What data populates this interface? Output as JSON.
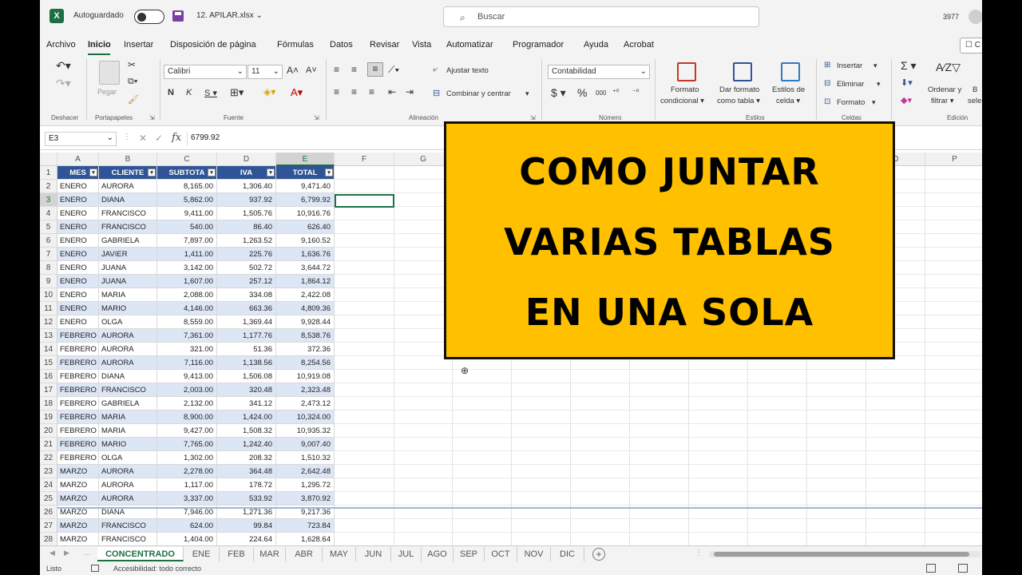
{
  "titlebar": {
    "autosave_label": "Autoguardado",
    "filename": "12. APILAR.xlsx ⌄",
    "search_placeholder": "Buscar",
    "user_text": "3977"
  },
  "menu": [
    "Archivo",
    "Inicio",
    "Insertar",
    "Disposición de página",
    "Fórmulas",
    "Datos",
    "Revisar",
    "Vista",
    "Automatizar",
    "Programador",
    "Ayuda",
    "Acrobat"
  ],
  "ribbon": {
    "undo_group": "Deshacer",
    "clipboard_group": "Portapapeles",
    "paste_label": "Pegar",
    "font_name": "Calibri",
    "font_size": "11",
    "font_group": "Fuente",
    "wrap_text": "Ajustar texto",
    "merge_center": "Combinar y centrar",
    "alignment_group": "Alineación",
    "number_format": "Contabilidad",
    "number_group": "Número",
    "cond_format_1": "Formato",
    "cond_format_2": "condicional ▾",
    "table_format_1": "Dar formato",
    "table_format_2": "como tabla ▾",
    "cell_styles_1": "Estilos de",
    "cell_styles_2": "celda ▾",
    "styles_group": "Estilos",
    "insert": "Insertar",
    "delete": "Eliminar",
    "format": "Formato",
    "cells_group": "Celdas",
    "sort_1": "Ordenar y",
    "sort_2": "filtrar ▾",
    "select_1": "B",
    "select_2": "sele",
    "edit_group": "Edición"
  },
  "formula_bar": {
    "name_box": "E3",
    "formula": "6799.92"
  },
  "columns": [
    "A",
    "B",
    "C",
    "D",
    "E",
    "F",
    "G",
    "H",
    "I",
    "J",
    "K",
    "L",
    "M",
    "N",
    "O",
    "P"
  ],
  "table": {
    "headers": [
      "MES",
      "CLIENTE",
      "SUBTOTA",
      "IVA",
      "TOTAL"
    ],
    "rows": [
      [
        "ENERO",
        "AURORA",
        "8,165.00",
        "1,306.40",
        "9,471.40"
      ],
      [
        "ENERO",
        "DIANA",
        "5,862.00",
        "937.92",
        "6,799.92"
      ],
      [
        "ENERO",
        "FRANCISCO",
        "9,411.00",
        "1,505.76",
        "10,916.76"
      ],
      [
        "ENERO",
        "FRANCISCO",
        "540.00",
        "86.40",
        "626.40"
      ],
      [
        "ENERO",
        "GABRIELA",
        "7,897.00",
        "1,263.52",
        "9,160.52"
      ],
      [
        "ENERO",
        "JAVIER",
        "1,411.00",
        "225.76",
        "1,636.76"
      ],
      [
        "ENERO",
        "JUANA",
        "3,142.00",
        "502.72",
        "3,644.72"
      ],
      [
        "ENERO",
        "JUANA",
        "1,607.00",
        "257.12",
        "1,864.12"
      ],
      [
        "ENERO",
        "MARIA",
        "2,088.00",
        "334.08",
        "2,422.08"
      ],
      [
        "ENERO",
        "MARIO",
        "4,146.00",
        "663.36",
        "4,809.36"
      ],
      [
        "ENERO",
        "OLGA",
        "8,559.00",
        "1,369.44",
        "9,928.44"
      ],
      [
        "FEBRERO",
        "AURORA",
        "7,361.00",
        "1,177.76",
        "8,538.76"
      ],
      [
        "FEBRERO",
        "AURORA",
        "321.00",
        "51.36",
        "372.36"
      ],
      [
        "FEBRERO",
        "AURORA",
        "7,116.00",
        "1,138.56",
        "8,254.56"
      ],
      [
        "FEBRERO",
        "DIANA",
        "9,413.00",
        "1,506.08",
        "10,919.08"
      ],
      [
        "FEBRERO",
        "FRANCISCO",
        "2,003.00",
        "320.48",
        "2,323.48"
      ],
      [
        "FEBRERO",
        "GABRIELA",
        "2,132.00",
        "341.12",
        "2,473.12"
      ],
      [
        "FEBRERO",
        "MARIA",
        "8,900.00",
        "1,424.00",
        "10,324.00"
      ],
      [
        "FEBRERO",
        "MARIA",
        "9,427.00",
        "1,508.32",
        "10,935.32"
      ],
      [
        "FEBRERO",
        "MARIO",
        "7,765.00",
        "1,242.40",
        "9,007.40"
      ],
      [
        "FEBRERO",
        "OLGA",
        "1,302.00",
        "208.32",
        "1,510.32"
      ],
      [
        "MARZO",
        "AURORA",
        "2,278.00",
        "364.48",
        "2,642.48"
      ],
      [
        "MARZO",
        "AURORA",
        "1,117.00",
        "178.72",
        "1,295.72"
      ],
      [
        "MARZO",
        "AURORA",
        "3,337.00",
        "533.92",
        "3,870.92"
      ],
      [
        "MARZO",
        "DIANA",
        "7,946.00",
        "1,271.36",
        "9,217.36"
      ],
      [
        "MARZO",
        "FRANCISCO",
        "624.00",
        "99.84",
        "723.84"
      ],
      [
        "MARZO",
        "FRANCISCO",
        "1,404.00",
        "224.64",
        "1,628.64"
      ]
    ]
  },
  "sheets": [
    "CONCENTRADO",
    "ENE",
    "FEB",
    "MAR",
    "ABR",
    "MAY",
    "JUN",
    "JUL",
    "AGO",
    "SEP",
    "OCT",
    "NOV",
    "DIC"
  ],
  "active_sheet": "CONCENTRADO",
  "status": {
    "ready": "Listo",
    "accessibility": "Accesibilidad: todo correcto"
  },
  "overlay": {
    "line1": "COMO JUNTAR",
    "line2": "VARIAS TABLAS",
    "line3": "EN UNA SOLA"
  },
  "colors": {
    "excel_green": "#1d6f42",
    "table_header": "#2f5597",
    "banded_row": "#dde6f5",
    "overlay_bg": "#ffc000"
  }
}
